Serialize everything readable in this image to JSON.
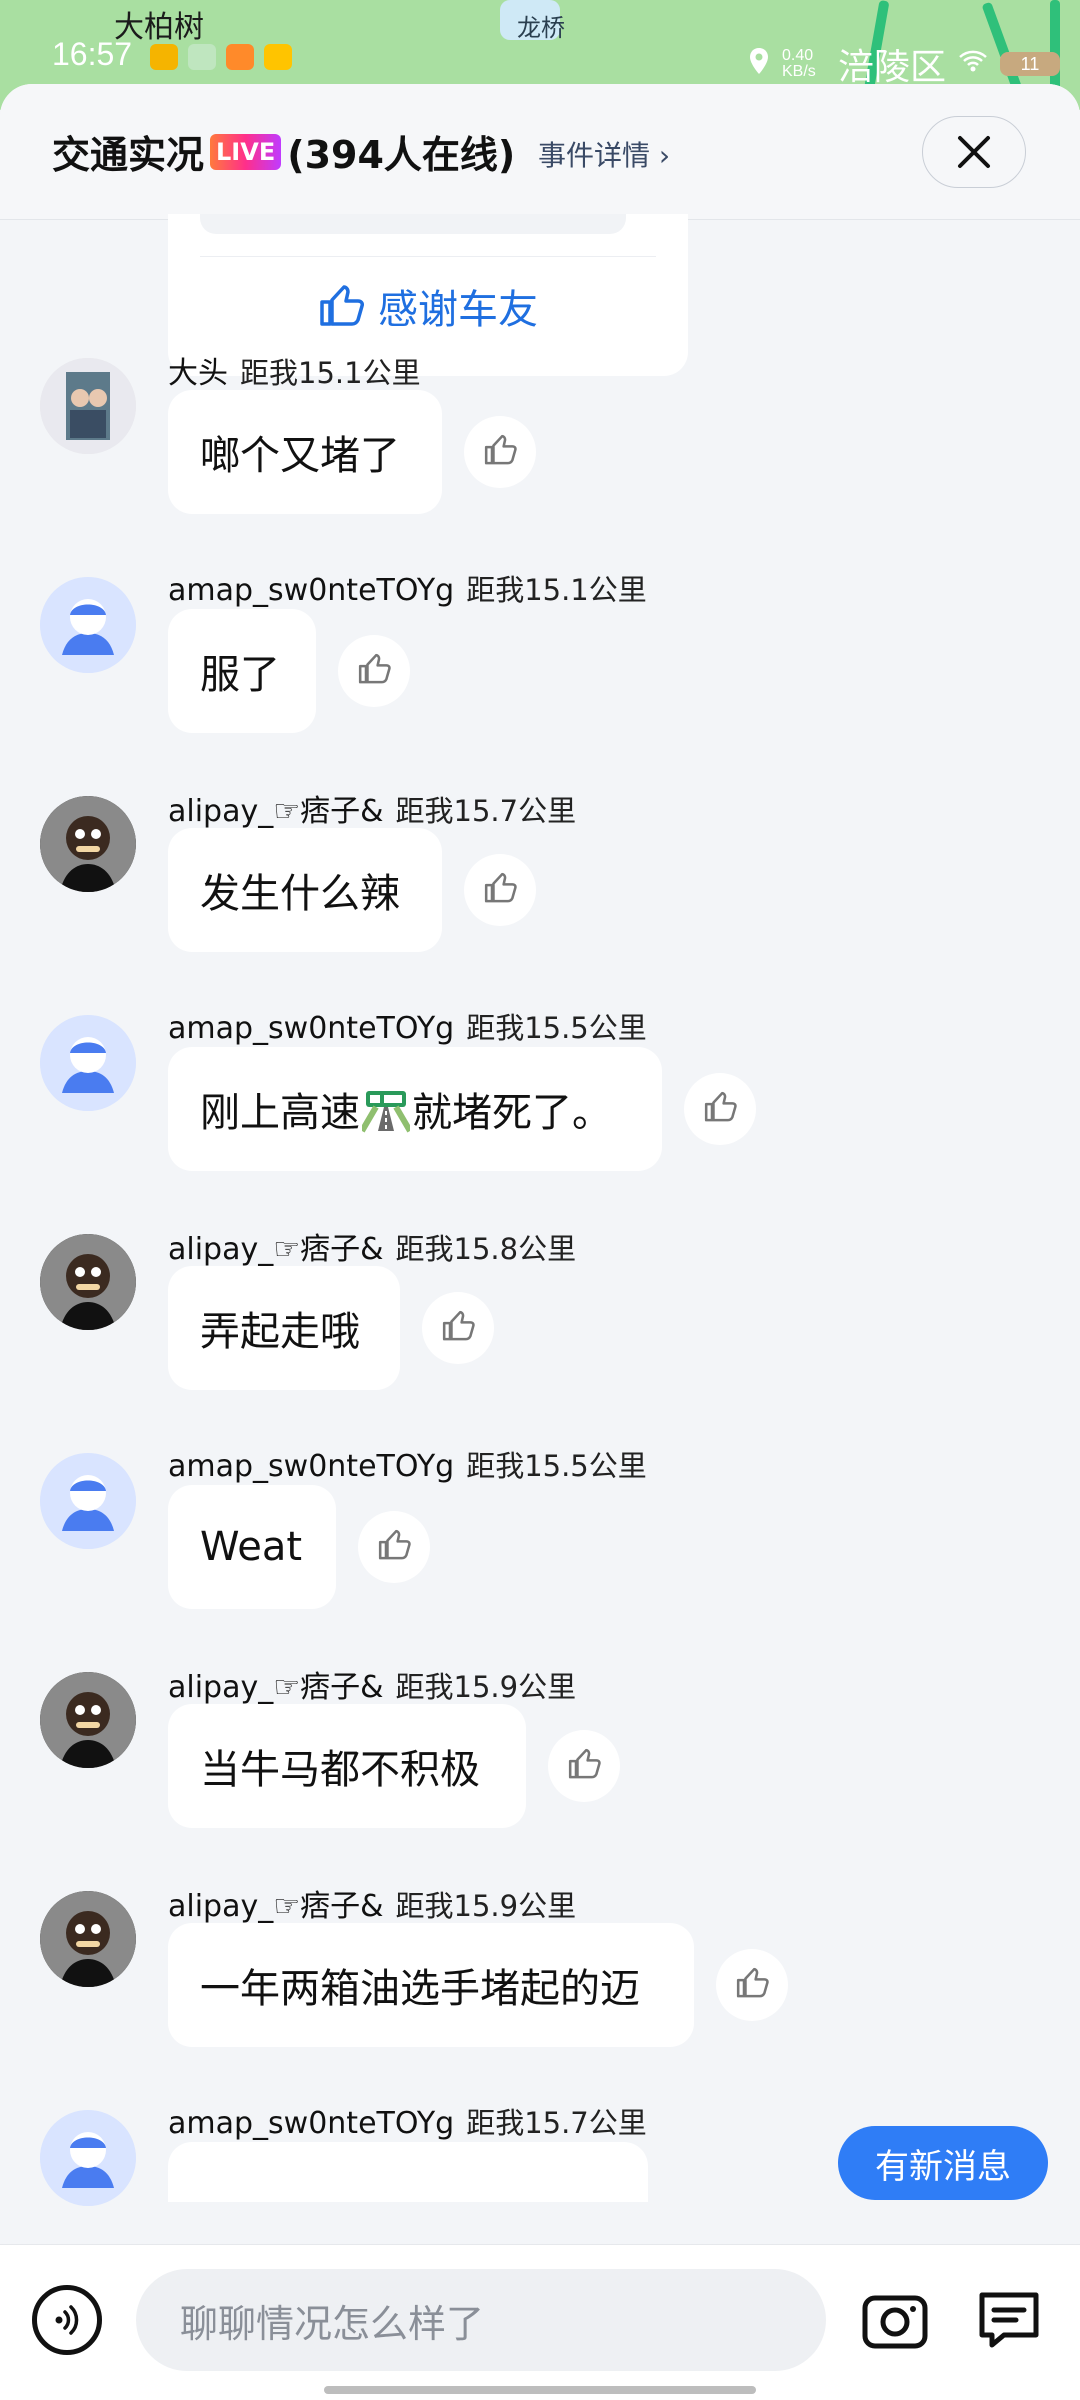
{
  "status_bar": {
    "time": "16:57",
    "map_label_1": "大柏树",
    "map_label_2": "龙桥",
    "net_speed": "0.40 KB/s",
    "district": "涪陵区",
    "battery": "11"
  },
  "header": {
    "title": "交通实况",
    "live_badge": "LIVE",
    "online": "(394人在线)",
    "event_link": "事件详情",
    "event_link_arrow": "›"
  },
  "thanks_card": {
    "label": "感谢车友"
  },
  "messages": [
    {
      "name": "大头",
      "distance": "距我15.1公里",
      "text": "啷个又堵了",
      "avatar": "photo"
    },
    {
      "name": "amap_sw0nteTOYg",
      "distance": "距我15.1公里",
      "text": "服了",
      "avatar": "default"
    },
    {
      "name": "alipay_☞痞子&",
      "distance": "距我15.7公里",
      "text": "发生什么辣",
      "avatar": "cartoon"
    },
    {
      "name": "amap_sw0nteTOYg",
      "distance": "距我15.5公里",
      "text_before": "刚上高速",
      "text_after": "就堵死了。",
      "avatar": "default"
    },
    {
      "name": "alipay_☞痞子&",
      "distance": "距我15.8公里",
      "text": "弄起走哦",
      "avatar": "cartoon"
    },
    {
      "name": "amap_sw0nteTOYg",
      "distance": "距我15.5公里",
      "text": "Weat",
      "avatar": "default"
    },
    {
      "name": "alipay_☞痞子&",
      "distance": "距我15.9公里",
      "text": "当牛马都不积极",
      "avatar": "cartoon"
    },
    {
      "name": "alipay_☞痞子&",
      "distance": "距我15.9公里",
      "text": "一年两箱油选手堵起的迈",
      "avatar": "cartoon"
    },
    {
      "name": "amap_sw0nteTOYg",
      "distance": "距我15.7公里",
      "avatar": "default"
    }
  ],
  "new_message_button": "有新消息",
  "input": {
    "placeholder": "聊聊情况怎么样了"
  },
  "colors": {
    "accent": "#2f7df6",
    "link_blue": "#1f6fe0",
    "background": "#f3f5f8"
  }
}
